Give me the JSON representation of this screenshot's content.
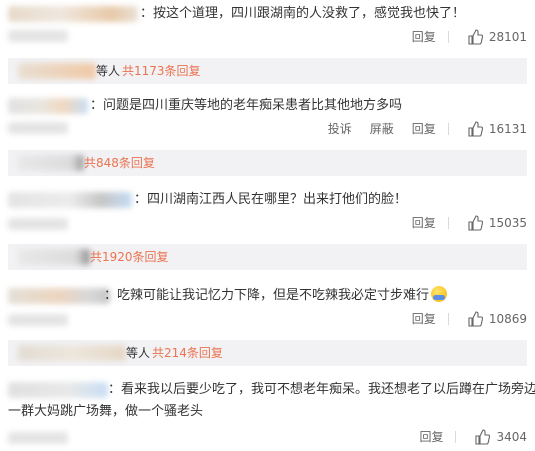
{
  "comments": [
    {
      "text": "：按这个道理，四川跟湖南的人没救了，感觉我也快了！",
      "actions": [
        "回复"
      ],
      "likes": "28101",
      "replies": {
        "prefix": "等人",
        "count": "共1173条回复"
      }
    },
    {
      "text": "：问题是四川重庆等地的老年痴呆患者比其他地方多吗",
      "actions": [
        "投诉",
        "屏蔽",
        "回复"
      ],
      "likes": "16131",
      "replies": {
        "prefix": "",
        "count": "共848条回复"
      }
    },
    {
      "text": "：四川湖南江西人民在哪里？出来打他们的脸！",
      "actions": [
        "回复"
      ],
      "likes": "15035",
      "replies": {
        "prefix": "",
        "count": "共1920条回复"
      }
    },
    {
      "text": "：吃辣可能让我记忆力下降，但是不吃辣我必定寸步难行",
      "emoji": "sweating-face-emoji",
      "actions": [
        "回复"
      ],
      "likes": "10869",
      "replies": {
        "prefix": "等人",
        "count": "共214条回复"
      }
    },
    {
      "text": "：看来我以后要少吃了，我可不想老年痴呆。我还想老了以后蹲在广场旁边看",
      "text2": "一群大妈跳广场舞，做一个骚老头",
      "actions": [
        "回复"
      ],
      "likes": "3404"
    }
  ],
  "colors": {
    "accent": "#eb7350",
    "reply_bg": "#f2f2f5",
    "text": "#333333",
    "muted": "#666666"
  }
}
